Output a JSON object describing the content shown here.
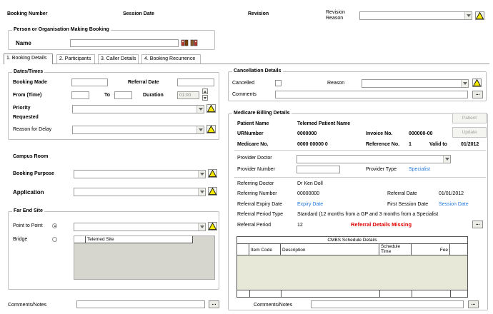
{
  "header": {
    "booking_number_label": "Booking Number",
    "session_date_label": "Session Date",
    "revision_label": "Revision",
    "revision_reason_label_1": "Revision",
    "revision_reason_label_2": "Reason"
  },
  "person": {
    "group_title": "Person or Organisation Making Booking",
    "name_label": "Name",
    "name_value": ""
  },
  "tabs": [
    {
      "label": "1. Booking Details",
      "active": true
    },
    {
      "label": "2. Participants",
      "active": false
    },
    {
      "label": "3. Caller Details",
      "active": false
    },
    {
      "label": "4. Booking Recurrence",
      "active": false
    }
  ],
  "dates": {
    "group_title": "Dates/Times",
    "booking_made_label": "Booking Made",
    "referral_date_label": "Referral Date",
    "from_time_label": "From (Time)",
    "to_label": "To",
    "duration_label": "Duration",
    "duration_value": "01:00",
    "priority_label": "Priority",
    "requested_label": "Requested",
    "reason_delay_label": "Reason for Delay"
  },
  "campus": {
    "campus_room_label": "Campus Room",
    "booking_purpose_label": "Booking Purpose",
    "application_label": "Application"
  },
  "far_end": {
    "group_title": "Far End Site",
    "point_to_point_label": "Point to Point",
    "bridge_label": "Bridge",
    "site_header": "Telemed Site"
  },
  "comments_notes": {
    "label": "Comments/Notes",
    "ellipsis": "..."
  },
  "cancellation": {
    "group_title": "Cancellation Details",
    "cancelled_label": "Cancelled",
    "reason_label": "Reason",
    "comments_label": "Comments",
    "ellipsis": "..."
  },
  "medicare": {
    "group_title": "Medicare Billing Details",
    "patient_button": "Patient",
    "update_button": "Update",
    "patient_name_label": "Patient Name",
    "patient_name_value": "Telemed Patient Name",
    "urnumber_label": "URNumber",
    "urnumber_value": "0000000",
    "invoice_label": "Invoice No.",
    "invoice_value": "000000-00",
    "medicare_no_label": "Medicare No.",
    "medicare_no_value": "0000 00000 0",
    "reference_label": "Reference No.",
    "reference_value": "1",
    "valid_to_label": "Valid to",
    "valid_to_value": "01/2012",
    "provider_doctor_label": "Provider Doctor",
    "provider_number_label": "Provider Number",
    "provider_type_label": "Provider Type",
    "provider_type_value": "Specialist",
    "referring_doctor_label": "Referring Doctor",
    "referring_doctor_value": "Dr Ken Doll",
    "referring_number_label": "Referring Number",
    "referring_number_value": "00000000",
    "referral_date_label": "Referral Date",
    "referral_date_value": "01/01/2012",
    "referral_expiry_label": "Referral Expiry Date",
    "referral_expiry_value": "Expiry Date",
    "first_session_label": "First Session Date",
    "first_session_value": "Session Date",
    "referral_period_type_label": "Referral Period Type",
    "referral_period_type_value": "Standard (12 months from a GP and 3 months from a Specialist",
    "referral_period_label": "Referral Period",
    "referral_period_value": "12",
    "referral_missing": "Referral Details Missing",
    "ellipsis": "...",
    "cmbs_title": "CMBS Schedule Details",
    "cmbs_columns": [
      "Item Code",
      "Description",
      "Schedule Time",
      "Fee"
    ],
    "comments_label": "Comments/Notes"
  },
  "colors": {
    "warning_yellow": "#f5e800",
    "link_blue": "#2277dd",
    "error_red": "#e00000",
    "panel_grey": "#d6d5ce",
    "grid_beige": "#e8e8d8"
  }
}
